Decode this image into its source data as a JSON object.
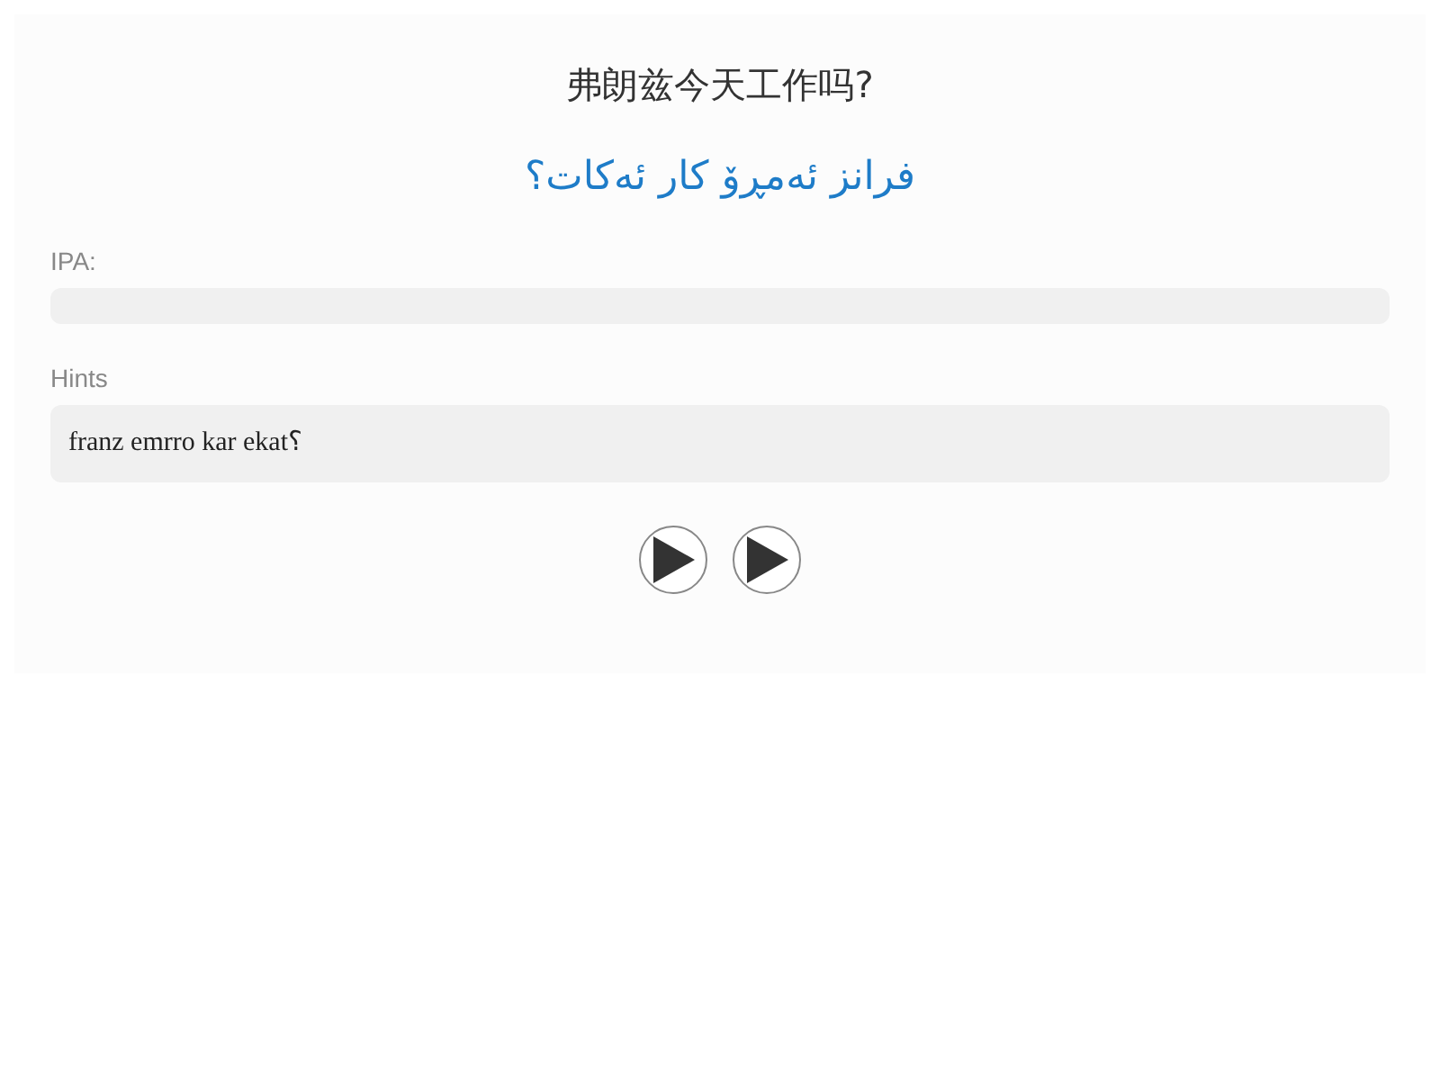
{
  "question": "弗朗兹今天工作吗?",
  "translation": "فرانز ئەمڕۆ کار ئەکات؟",
  "fields": [
    {
      "label": "IPA:"
    },
    {
      "label": "Hints",
      "value": "franz emrro kar ekat؟"
    }
  ],
  "play_buttons": [
    {
      "kind": "play"
    },
    {
      "kind": "play"
    }
  ]
}
